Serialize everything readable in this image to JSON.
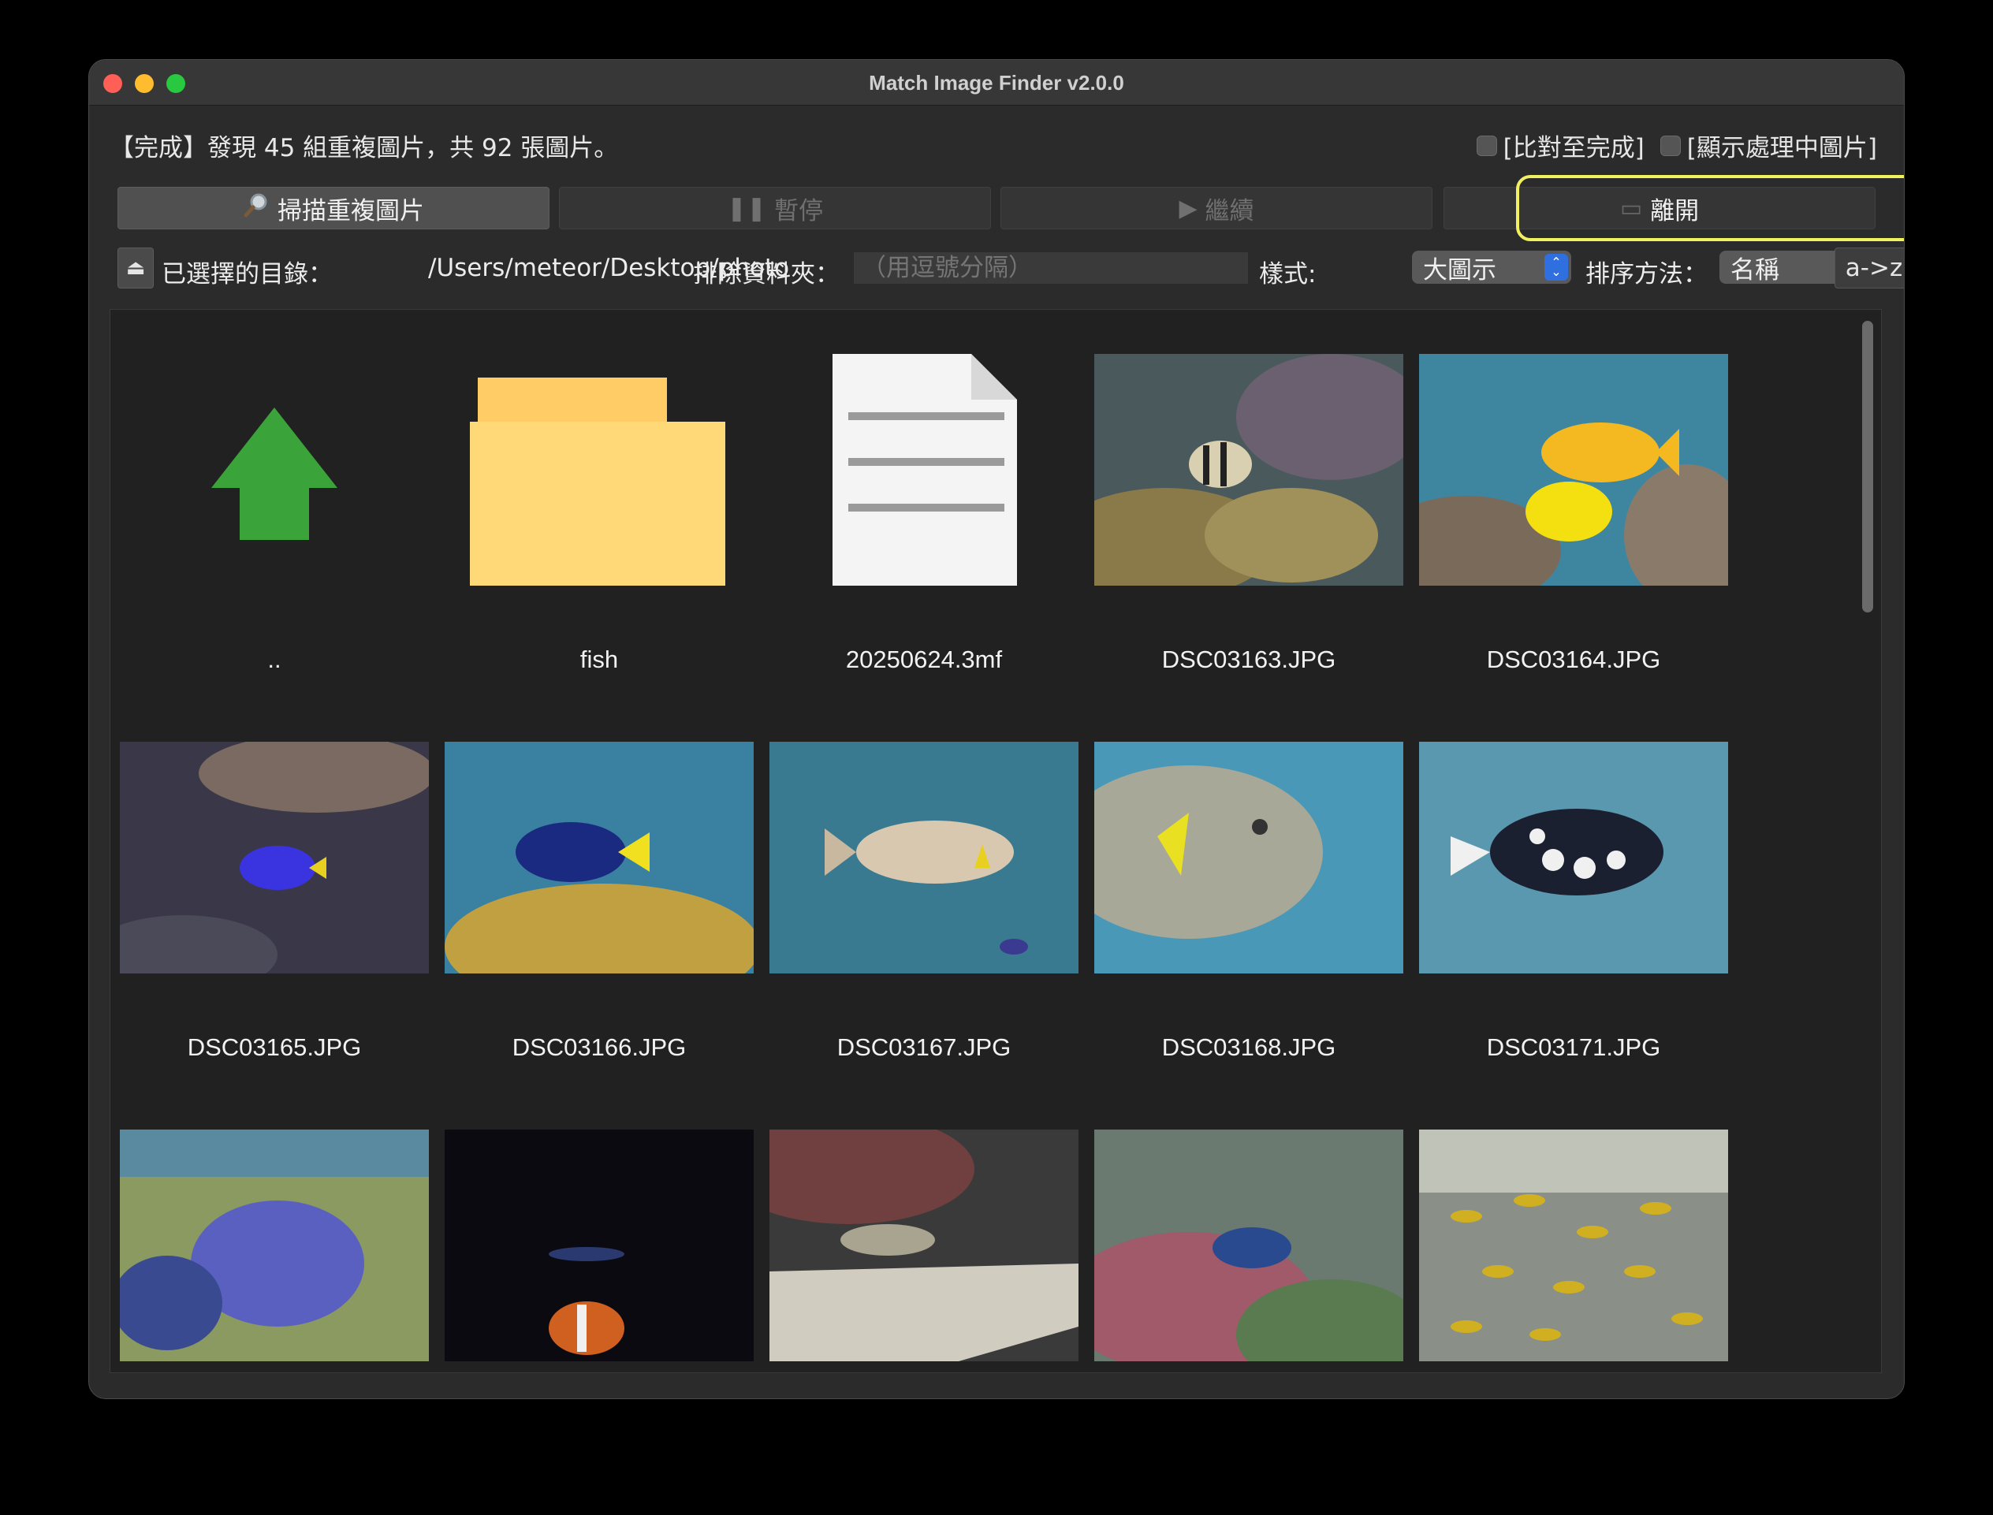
{
  "window": {
    "title": "Match Image Finder v2.0.0"
  },
  "status": {
    "text": "【完成】發現 45 組重複圖片，共 92 張圖片。"
  },
  "options": {
    "compare_to_finish": "[比對至完成]",
    "show_processing": "[顯示處理中圖片]"
  },
  "toolbar": {
    "scan_label": "掃描重複圖片",
    "pause_label": "暫停",
    "resume_label": "繼續",
    "exit_label": "離開"
  },
  "pathbar": {
    "selected_dir_label": "已選擇的目錄：",
    "selected_dir_value": "/Users/meteor/Desktop/photo",
    "exclude_label": "排除資料夾：",
    "exclude_placeholder": "（用逗號分隔）",
    "style_label": "樣式:",
    "style_value": "大圖示",
    "sort_label": "排序方法：",
    "sort_value": "名稱",
    "sort_order": "a->z"
  },
  "files": [
    {
      "name": "..",
      "kind": "parent",
      "icon": "up-arrow-icon"
    },
    {
      "name": "fish",
      "kind": "folder",
      "icon": "folder-icon"
    },
    {
      "name": "20250624.3mf",
      "kind": "file",
      "icon": "document-icon"
    },
    {
      "name": "DSC03163.JPG",
      "kind": "image"
    },
    {
      "name": "DSC03164.JPG",
      "kind": "image"
    },
    {
      "name": "DSC03165.JPG",
      "kind": "image"
    },
    {
      "name": "DSC03166.JPG",
      "kind": "image"
    },
    {
      "name": "DSC03167.JPG",
      "kind": "image"
    },
    {
      "name": "DSC03168.JPG",
      "kind": "image"
    },
    {
      "name": "DSC03171.JPG",
      "kind": "image"
    },
    {
      "name": "",
      "kind": "image"
    },
    {
      "name": "",
      "kind": "image"
    },
    {
      "name": "",
      "kind": "image"
    },
    {
      "name": "",
      "kind": "image"
    },
    {
      "name": "",
      "kind": "image"
    }
  ],
  "colors": {
    "highlight": "#f0f060",
    "select_accent": "#2f6fe0",
    "arrow_green": "#3aa43a",
    "folder_yellow": "#ffd878"
  }
}
